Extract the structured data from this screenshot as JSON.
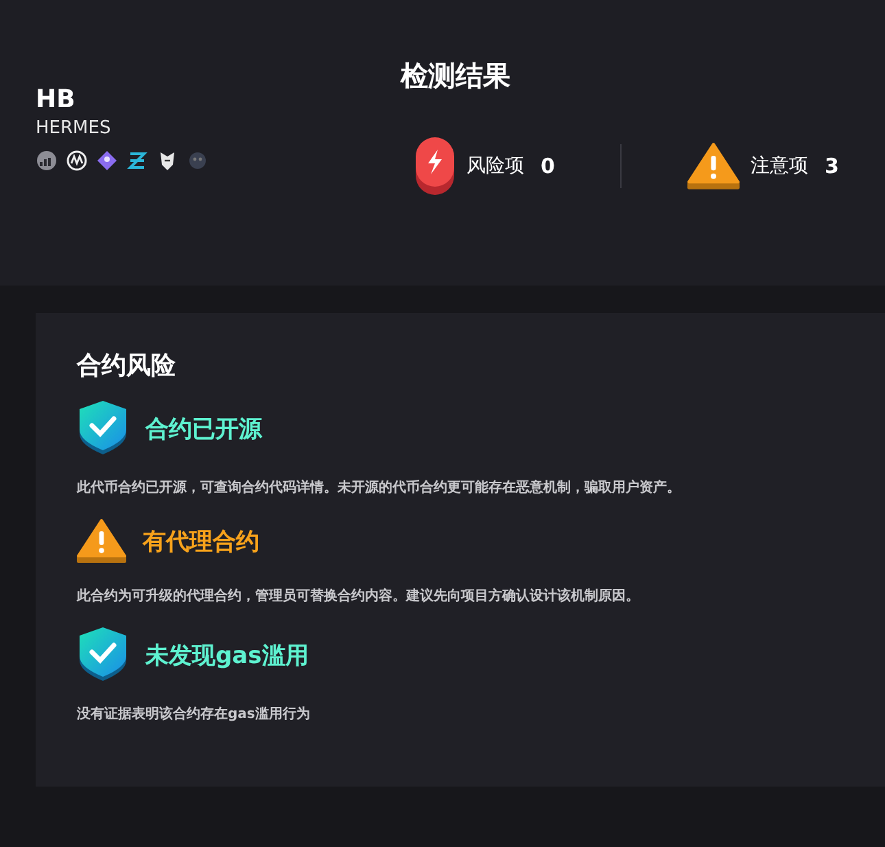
{
  "token": {
    "symbol": "HB",
    "name": "HERMES"
  },
  "summary": {
    "title": "检测结果",
    "stats": [
      {
        "kind": "risk",
        "label": "风险项",
        "count": "0"
      },
      {
        "kind": "warning",
        "label": "注意项",
        "count": "3"
      }
    ]
  },
  "section": {
    "title": "合约风险",
    "items": [
      {
        "kind": "safe",
        "title": "合约已开源",
        "description": "此代币合约已开源，可查询合约代码详情。未开源的代币合约更可能存在恶意机制，骗取用户资产。"
      },
      {
        "kind": "warning",
        "title": "有代理合约",
        "description": "此合约为可升级的代理合约，管理员可替换合约内容。建议先向项目方确认设计该机制原因。"
      },
      {
        "kind": "safe",
        "title": "未发现gas滥用",
        "description": "没有证据表明该合约存在gas滥用行为"
      }
    ]
  }
}
